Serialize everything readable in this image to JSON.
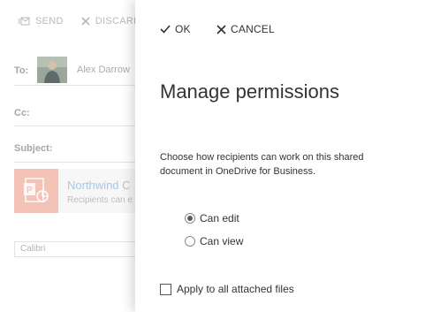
{
  "compose": {
    "toolbar": {
      "send_label": "SEND",
      "discard_label": "DISCARD"
    },
    "to": {
      "label": "To:",
      "recipient": "Alex Darrow"
    },
    "cc": {
      "label": "Cc:"
    },
    "subject": {
      "label": "Subject:"
    },
    "attachment": {
      "name": "Northwind C",
      "subtitle": "Recipients can e"
    },
    "font": "Calibri"
  },
  "panel": {
    "ok_label": "OK",
    "cancel_label": "CANCEL",
    "title": "Manage permissions",
    "description": "Choose how recipients can work on this shared document in OneDrive for Business.",
    "options": [
      {
        "label": "Can edit",
        "selected": true
      },
      {
        "label": "Can view",
        "selected": false
      }
    ],
    "apply_all_label": "Apply to all attached files",
    "apply_all_checked": false
  },
  "colors": {
    "accent_attachment": "#f4c3b8",
    "link_text": "#a7c8ea",
    "text_primary": "#333333"
  }
}
